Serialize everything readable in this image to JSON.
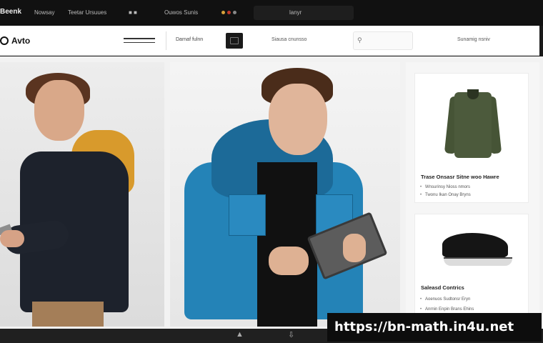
{
  "topbar": {
    "brand": "Beenk",
    "items": [
      "Nowsay",
      "Teetar Ursuues",
      "Ouwos Sunis"
    ],
    "right_label": "lanyr"
  },
  "header": {
    "logo": "Avto",
    "nav_label": "Darnaf fulnn",
    "link": "Siausa cnunsso",
    "right_link": "Sunamig nsniv"
  },
  "cards": [
    {
      "title": "Trase Onsasr Sitne woo Hawre",
      "lines": [
        "Wnsurinsy Nioss nmors",
        "Twonu Ikan Onay Bryns"
      ]
    },
    {
      "title": "Saleasd Contrics",
      "lines": [
        "Aoenuos Sudtonsr Eryn",
        "Anrnin Enpin Brans Ehins"
      ]
    }
  ],
  "watermark": "https://bn-math.in4u.net",
  "colors": {
    "topbar": "#111111",
    "accent_blue": "#2483b7",
    "accent_mustard": "#d89a2c",
    "olive": "#4c5a3c"
  }
}
